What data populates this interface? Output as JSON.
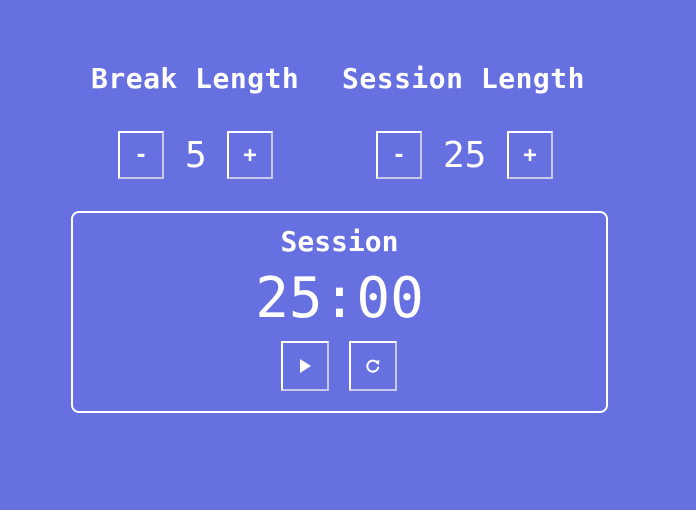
{
  "break": {
    "label": "Break Length",
    "value": "5",
    "decrement_label": "-",
    "increment_label": "+"
  },
  "session": {
    "label": "Session Length",
    "value": "25",
    "decrement_label": "-",
    "increment_label": "+"
  },
  "timer": {
    "label": "Session",
    "time": "25:00",
    "start_icon": "play-icon",
    "reset_icon": "refresh-icon"
  },
  "colors": {
    "background": "#6770e0",
    "foreground": "#ffffff"
  }
}
